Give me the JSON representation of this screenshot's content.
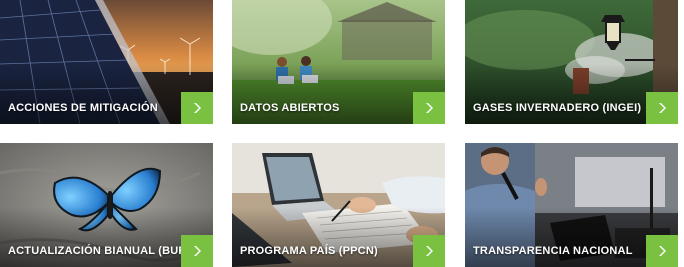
{
  "colors": {
    "accent": "#7ac142",
    "label_text": "#ffffff"
  },
  "tiles": [
    {
      "label": "ACCIONES DE MITIGACIÓN",
      "image": "solar-panels-wind-turbines-sunset",
      "action_icon": "arrow-right-icon"
    },
    {
      "label": "DATOS ABIERTOS",
      "image": "people-with-laptops-on-grass",
      "action_icon": "arrow-right-icon"
    },
    {
      "label": "GASES INVERNADERO (INGEI)",
      "image": "chimney-smoke-street-lamp-forest",
      "action_icon": "arrow-right-icon"
    },
    {
      "label": "ACTUALIZACIÓN BIANUAL (BUR)",
      "image": "blue-morpho-butterfly-on-rock",
      "action_icon": "arrow-right-icon"
    },
    {
      "label": "PROGRAMA PAÍS (PPCN)",
      "image": "hands-laptop-documents-desk",
      "action_icon": "arrow-right-icon"
    },
    {
      "label": "TRANSPARENCIA NACIONAL",
      "image": "speaker-with-microphone-at-conference",
      "action_icon": "arrow-right-icon"
    }
  ]
}
